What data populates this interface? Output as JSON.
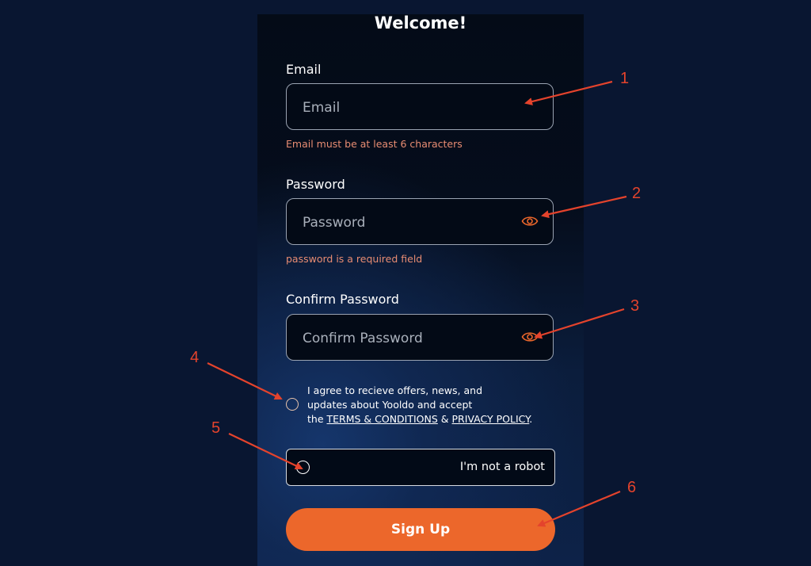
{
  "form": {
    "title": "Welcome!",
    "email": {
      "label": "Email",
      "placeholder": "Email",
      "value": "",
      "error": "Email must be at least 6 characters"
    },
    "password": {
      "label": "Password",
      "placeholder": "Password",
      "value": "",
      "error": "password is a required field",
      "toggle_icon": "eye-icon"
    },
    "confirm_password": {
      "label": "Confirm Password",
      "placeholder": "Confirm Password",
      "value": "",
      "toggle_icon": "eye-icon"
    },
    "agreement": {
      "line1": "I agree to recieve offers, news, and",
      "line2": "updates about Yooldo and accept",
      "line3_prefix": "the ",
      "terms_link": "TERMS & CONDITIONS",
      "joiner": " & ",
      "privacy_link": "PRIVACY POLICY",
      "suffix": ".",
      "checked": false
    },
    "captcha": {
      "label": "I'm not a robot",
      "checked": false
    },
    "submit_label": "Sign Up"
  },
  "colors": {
    "accent": "#ec672b",
    "error": "#e88c72",
    "annotation": "#e4432c",
    "background": "#091631"
  },
  "annotations": [
    {
      "number": "1",
      "target": "email-input"
    },
    {
      "number": "2",
      "target": "password-visibility-toggle"
    },
    {
      "number": "3",
      "target": "confirm-password-visibility-toggle"
    },
    {
      "number": "4",
      "target": "agreement-checkbox"
    },
    {
      "number": "5",
      "target": "captcha-checkbox"
    },
    {
      "number": "6",
      "target": "sign-up-button"
    }
  ]
}
